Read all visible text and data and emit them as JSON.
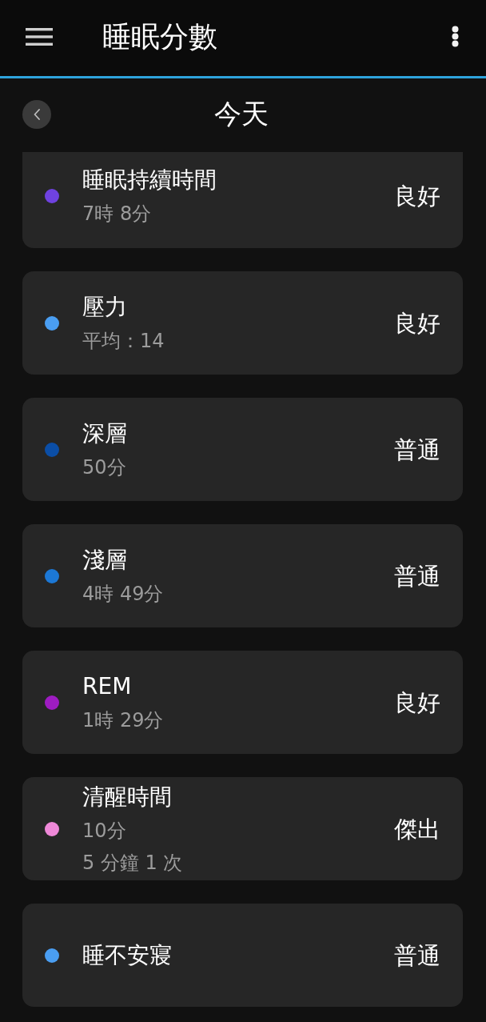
{
  "app_bar": {
    "title": "睡眠分數"
  },
  "date_nav": {
    "label": "今天"
  },
  "metrics": [
    {
      "title": "睡眠持續時間",
      "details": [
        "7時 8分"
      ],
      "rating": "良好",
      "color": "#6f42e0"
    },
    {
      "title": "壓力",
      "details": [
        "平均：14"
      ],
      "rating": "良好",
      "color": "#4a9ef2"
    },
    {
      "title": "深層",
      "details": [
        "50分"
      ],
      "rating": "普通",
      "color": "#0b4ea6"
    },
    {
      "title": "淺層",
      "details": [
        "4時 49分"
      ],
      "rating": "普通",
      "color": "#1c78d6"
    },
    {
      "title": "REM",
      "details": [
        "1時 29分"
      ],
      "rating": "良好",
      "color": "#9e1cc2"
    },
    {
      "title": "清醒時間",
      "details": [
        "10分",
        "5 分鐘 1 次"
      ],
      "rating": "傑出",
      "color": "#ee88d8"
    },
    {
      "title": "睡不安寢",
      "rating": "普通",
      "color": "#4a9ef2"
    }
  ]
}
